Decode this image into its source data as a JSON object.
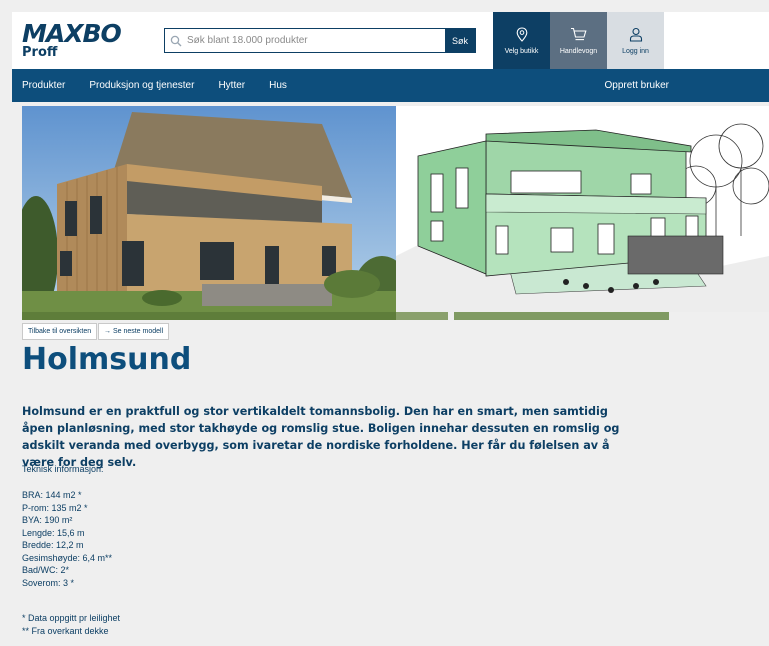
{
  "header": {
    "brand": "MAXBO",
    "brand_sub": "Proff",
    "search_placeholder": "Søk blant 18.000 produkter",
    "search_button": "Søk",
    "store_label": "Velg butikk",
    "cart_label": "Handlevogn",
    "login_label": "Logg inn"
  },
  "nav": {
    "items": [
      "Produkter",
      "Produksjon og tjenester",
      "Hytter",
      "Hus"
    ],
    "signup": "Opprett bruker"
  },
  "buttons": {
    "back": "Tilbake til oversikten",
    "next": "→ Se neste modell"
  },
  "product": {
    "title": "Holmsund",
    "description": "Holmsund er en praktfull og stor vertikaldelt tomannsbolig. Den har en smart, men samtidig åpen planløsning, med stor takhøyde og romslig stue. Boligen innehar dessuten en romslig og adskilt veranda med overbygg, som ivaretar de nordiske forholdene. Her får du følelsen av å være for deg selv.",
    "tech_heading": "Teknisk informasjon:",
    "specs": [
      "BRA: 144 m2 *",
      "P-rom: 135 m2 *",
      "BYA: 190 m²",
      "Lengde: 15,6 m",
      "Bredde: 12,2 m",
      "Gesimshøyde: 6,4 m**",
      "Bad/WC: 2*",
      "Soverom: 3 *"
    ],
    "notes": [
      "* Data oppgitt pr leilighet",
      "** Fra overkant dekke"
    ]
  },
  "icons": {
    "search": "search-icon",
    "store": "location-pin-icon",
    "cart": "cart-icon",
    "login": "user-icon"
  },
  "colors": {
    "brand": "#0d3f64",
    "nav": "#0d4e7c",
    "cart_bg": "#5c6f82",
    "login_bg": "#d8dde2"
  }
}
